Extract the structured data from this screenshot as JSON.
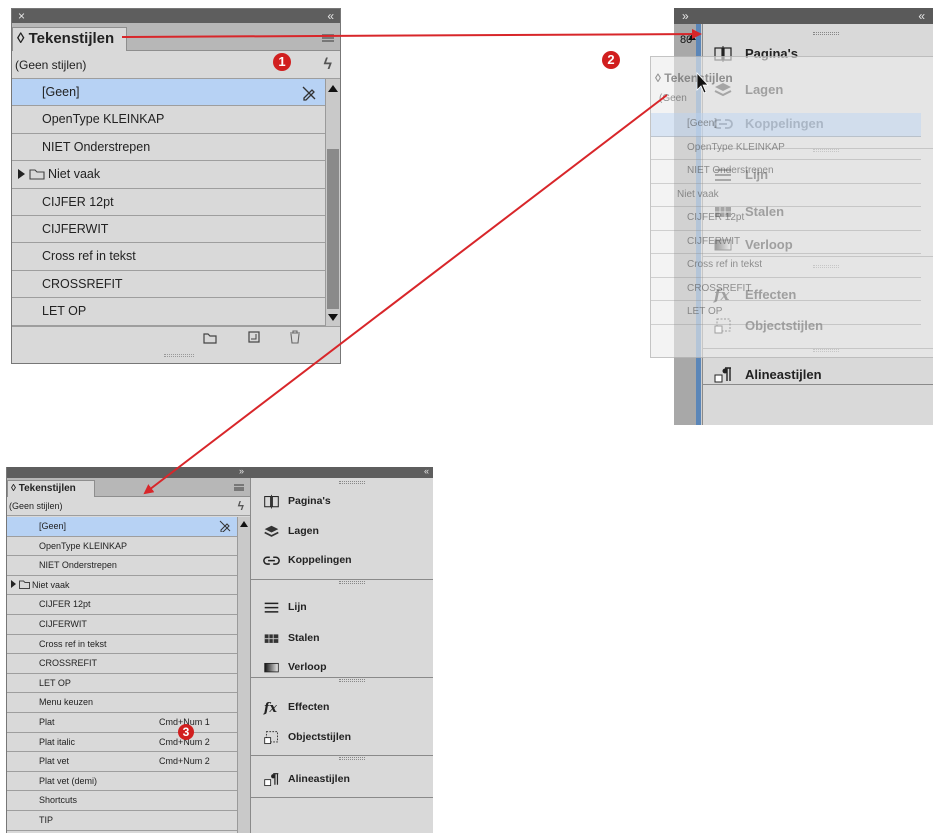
{
  "panel_a": {
    "titlebar": {
      "close": "×",
      "collapse": "«"
    },
    "tab_label": "◊ Tekenstijlen",
    "current_style": "(Geen stijlen)",
    "lightning": "ϟ",
    "rows": [
      "[Geen]",
      "OpenType KLEINKAP",
      "NIET Onderstrepen",
      "Niet vaak",
      "CIJFER 12pt",
      "CIJFERWIT",
      "Cross ref in tekst",
      "CROSSREFIT",
      "LET OP"
    ]
  },
  "badges": {
    "one": "1",
    "two": "2",
    "three": "3"
  },
  "panel_b": {
    "expand": "»",
    "collapse": "«",
    "ruler_label": "80",
    "items": [
      "Pagina's",
      "Lagen",
      "Koppelingen",
      "Lijn",
      "Stalen",
      "Verloop",
      "Effecten",
      "Objectstijlen",
      "Alineastijlen"
    ],
    "ghost": {
      "tab_label": "◊ Tekenstijlen",
      "current_style": "(Geen",
      "rows": [
        "[Geen]",
        "OpenType KLEINKAP",
        "NIET Onderstrepen",
        "Niet vaak",
        "CIJFER 12pt",
        "CIJFERWIT",
        "Cross ref in tekst",
        "CROSSREFIT",
        "LET OP"
      ]
    }
  },
  "panel_c": {
    "expand": "»",
    "collapse": "«",
    "tab_label": "◊ Tekenstijlen",
    "current_style": "(Geen stijlen)",
    "lightning": "ϟ",
    "rows": [
      {
        "name": "[Geen]",
        "shortcut": ""
      },
      {
        "name": "OpenType KLEINKAP",
        "shortcut": ""
      },
      {
        "name": "NIET Onderstrepen",
        "shortcut": ""
      },
      {
        "name": "Niet vaak",
        "shortcut": ""
      },
      {
        "name": "CIJFER 12pt",
        "shortcut": ""
      },
      {
        "name": "CIJFERWIT",
        "shortcut": ""
      },
      {
        "name": "Cross ref in tekst",
        "shortcut": ""
      },
      {
        "name": "CROSSREFIT",
        "shortcut": ""
      },
      {
        "name": "LET OP",
        "shortcut": ""
      },
      {
        "name": "Menu keuzen",
        "shortcut": ""
      },
      {
        "name": "Plat",
        "shortcut": "Cmd+Num 1"
      },
      {
        "name": "Plat italic",
        "shortcut": "Cmd+Num 2"
      },
      {
        "name": "Plat vet",
        "shortcut": "Cmd+Num 2"
      },
      {
        "name": "Plat vet (demi)",
        "shortcut": ""
      },
      {
        "name": "Shortcuts",
        "shortcut": ""
      },
      {
        "name": "TIP",
        "shortcut": ""
      }
    ],
    "dock_items": [
      "Pagina's",
      "Lagen",
      "Koppelingen",
      "Lijn",
      "Stalen",
      "Verloop",
      "Effecten",
      "Objectstijlen",
      "Alineastijlen"
    ]
  },
  "colors": {
    "arrow": "#d8262a",
    "selection": "#b7d2f4",
    "badge": "#d11f1f"
  }
}
